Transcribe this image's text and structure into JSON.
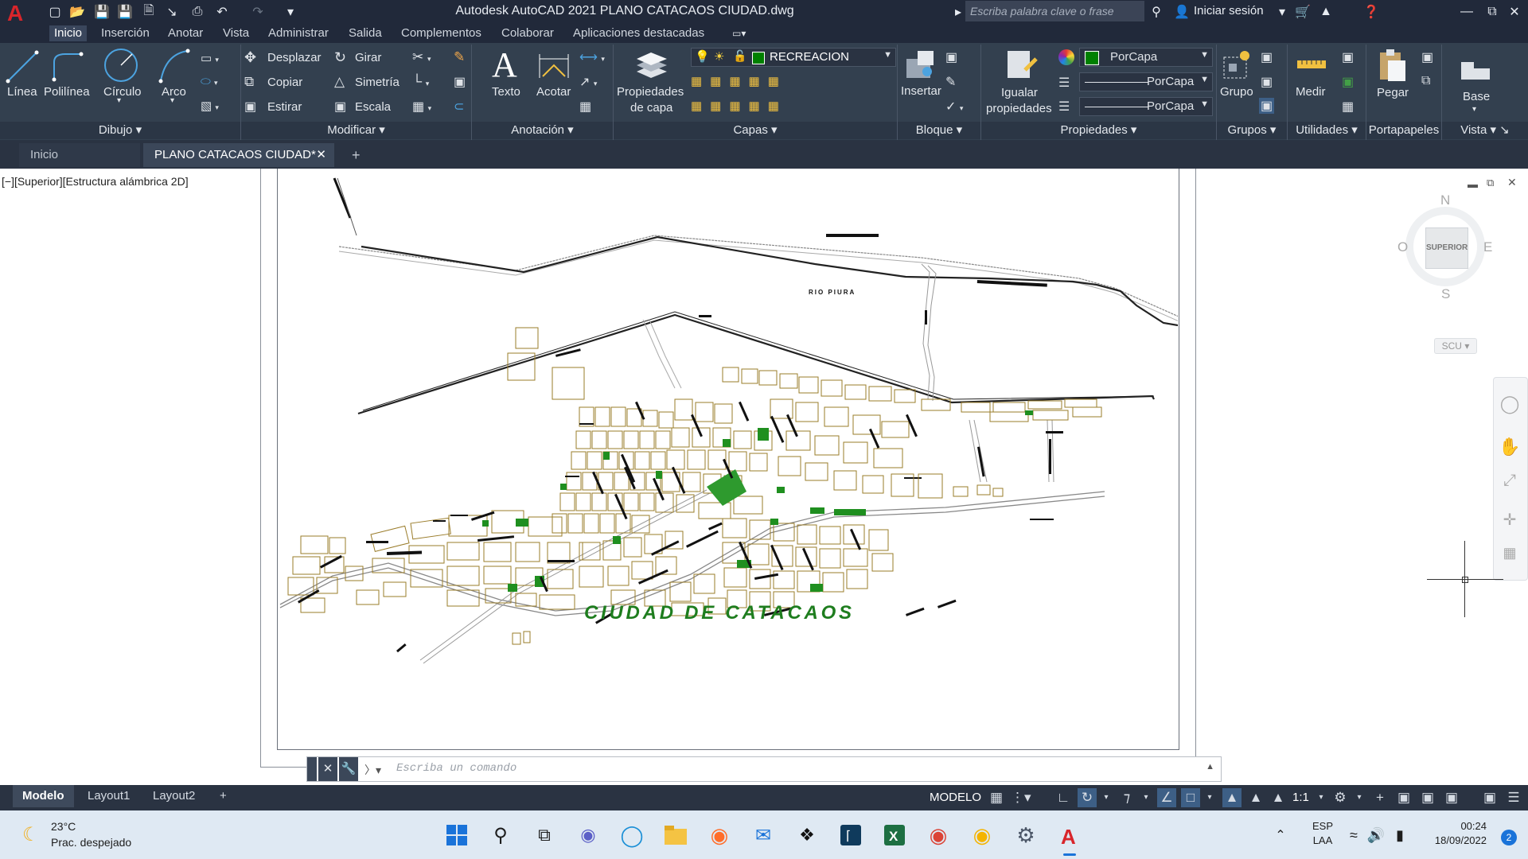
{
  "title_bar": {
    "app_title": "Autodesk AutoCAD 2021    PLANO CATACAOS CIUDAD.dwg",
    "search_placeholder": "Escriba palabra clave o frase",
    "signin": "Iniciar sesión"
  },
  "menu_tabs": [
    "Inicio",
    "Inserción",
    "Anotar",
    "Vista",
    "Administrar",
    "Salida",
    "Complementos",
    "Colaborar",
    "Aplicaciones destacadas"
  ],
  "ribbon": {
    "draw": {
      "linea": "Línea",
      "polilinea": "Polilínea",
      "circulo": "Círculo",
      "arco": "Arco"
    },
    "modify": {
      "desplazar": "Desplazar",
      "girar": "Girar",
      "copiar": "Copiar",
      "simetria": "Simetría",
      "estirar": "Estirar",
      "escala": "Escala"
    },
    "annotation": {
      "texto": "Texto",
      "acotar": "Acotar"
    },
    "layers": {
      "propiedades_1": "Propiedades",
      "propiedades_2": "de capa",
      "current_layer": "RECREACION",
      "layer_color": "#008000"
    },
    "block": {
      "insertar": "Insertar"
    },
    "properties": {
      "igualar_1": "Igualar",
      "igualar_2": "propiedades",
      "color": "PorCapa",
      "linetype": "PorCapa",
      "lineweight": "PorCapa"
    },
    "groups": {
      "grupo": "Grupo"
    },
    "utilities": {
      "medir": "Medir"
    },
    "clipboard": {
      "pegar": "Pegar"
    },
    "view": {
      "base": "Base"
    },
    "panels": [
      "Dibujo",
      "Modificar",
      "Anotación",
      "Capas",
      "Bloque",
      "Propiedades",
      "Grupos",
      "Utilidades",
      "Portapapeles",
      "Vista"
    ]
  },
  "doc_tabs": {
    "home": "Inicio",
    "file": "PLANO CATACAOS CIUDAD*"
  },
  "viewport": {
    "label": "[−][Superior][Estructura alámbrica 2D]",
    "drawing_title": "CIUDAD DE CATACAOS",
    "river_label": "RIO PIURA",
    "viewcube": {
      "n": "N",
      "s": "S",
      "e": "E",
      "w": "O",
      "face": "SUPERIOR",
      "ucs": "SCU"
    }
  },
  "command_line": {
    "placeholder": "Escriba un comando"
  },
  "layout_tabs": [
    "Modelo",
    "Layout1",
    "Layout2"
  ],
  "status": {
    "model": "MODELO",
    "scale": "1:1"
  },
  "taskbar": {
    "weather_temp": "23°C",
    "weather_desc": "Prac. despejado",
    "lang_1": "ESP",
    "lang_2": "LAA",
    "time": "00:24",
    "date": "18/09/2022",
    "notif_count": "2"
  },
  "colors": {
    "ribbon_bg": "#33404f",
    "title_bg": "#21293a",
    "city_blocks": "#9a7c2a",
    "green_areas": "#1f8f1f",
    "title_green": "#1e7d1e"
  }
}
